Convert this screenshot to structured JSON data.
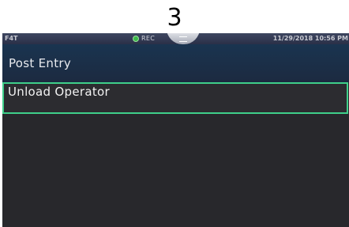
{
  "figure_label": "3",
  "status_bar": {
    "model": "F4T",
    "rec_label": "REC",
    "datetime": "11/29/2018 10:56 PM"
  },
  "page": {
    "title": "Post Entry"
  },
  "list": {
    "items": [
      {
        "label": "Unload Operator",
        "selected": true
      }
    ]
  },
  "colors": {
    "selection_border": "#3fcf8a",
    "rec_indicator": "#3cb84a",
    "background": "#28282c",
    "title_bar": "#1c2a40"
  },
  "icons": {
    "rec": "rec-status-icon",
    "menu": "menu-pulldown-icon"
  }
}
